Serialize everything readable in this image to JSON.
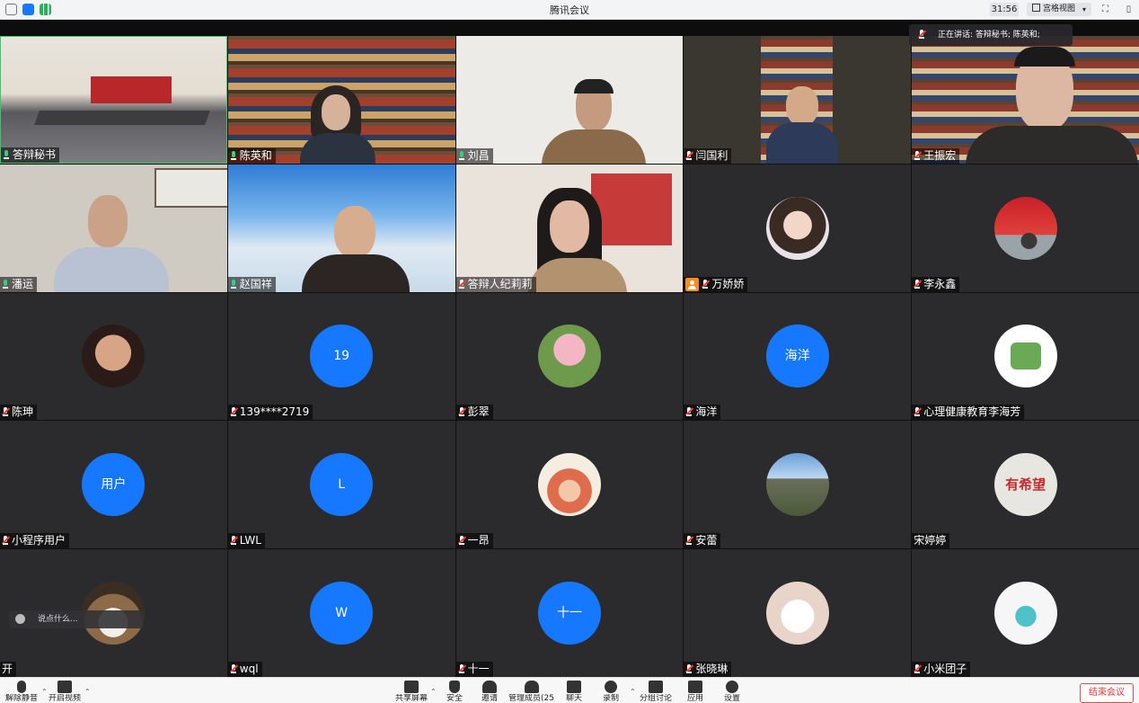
{
  "window": {
    "title": "腾讯会议",
    "timer": "31:56",
    "view_mode": "宫格视图"
  },
  "speaking_now": "正在讲话: 答辩秘书; 陈英和;",
  "chat_placeholder": "说点什么...",
  "colors": {
    "accent_blue": "#1677ff",
    "tile_bg": "#2b2b2e",
    "end_red": "#e53935",
    "host_orange": "#ff8a1e"
  },
  "participants": [
    {
      "name": "答辩秘书",
      "mic": "on"
    },
    {
      "name": "陈英和",
      "mic": "on"
    },
    {
      "name": "刘昌",
      "mic": "on"
    },
    {
      "name": "闫国利",
      "mic": "muted"
    },
    {
      "name": "王振宏",
      "mic": "muted"
    },
    {
      "name": "潘运",
      "mic": "on"
    },
    {
      "name": "赵国祥",
      "mic": "on"
    },
    {
      "name": "答辩人纪莉莉",
      "mic": "muted"
    },
    {
      "name": "万娇娇",
      "mic": "muted",
      "host": true
    },
    {
      "name": "李永鑫",
      "mic": "muted"
    },
    {
      "name": "陈珅",
      "mic": "muted"
    },
    {
      "name": "139****2719",
      "mic": "muted",
      "avatar_text": "19"
    },
    {
      "name": "彭翠",
      "mic": "muted"
    },
    {
      "name": "海洋",
      "mic": "muted",
      "avatar_text": "海洋"
    },
    {
      "name": "心理健康教育李海芳",
      "mic": "muted"
    },
    {
      "name": "小程序用户",
      "mic": "muted",
      "avatar_text": "用户"
    },
    {
      "name": "LWL",
      "mic": "muted",
      "avatar_text": "L"
    },
    {
      "name": "一昂",
      "mic": "muted"
    },
    {
      "name": "安蕾",
      "mic": "muted"
    },
    {
      "name": "宋婷婷",
      "mic": "none",
      "avatar_sign": "有希望"
    },
    {
      "name": "开",
      "mic": "none"
    },
    {
      "name": "wql",
      "mic": "muted",
      "avatar_text": "W"
    },
    {
      "name": "十一",
      "mic": "muted",
      "avatar_text": "十一"
    },
    {
      "name": "张晓琳",
      "mic": "muted"
    },
    {
      "name": "小米团子",
      "mic": "muted"
    }
  ],
  "toolbar": {
    "mute": "解除静音",
    "video": "开启视频",
    "share": "共享屏幕",
    "security": "安全",
    "invite": "邀请",
    "members": "管理成员(25)",
    "chat": "聊天",
    "record": "录制",
    "breakout": "分组讨论",
    "apps": "应用",
    "settings": "设置",
    "end": "结束会议"
  }
}
